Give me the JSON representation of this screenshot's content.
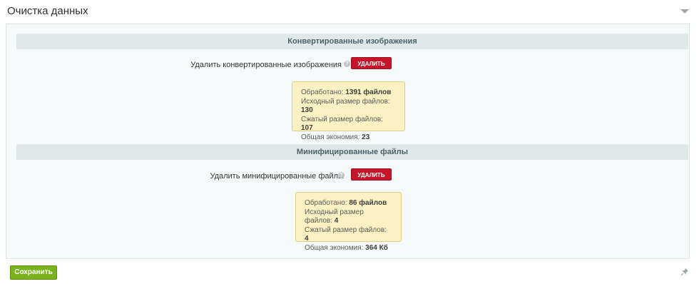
{
  "header": {
    "title": "Очистка данных",
    "toggle_icon": "chevron-down-icon"
  },
  "sections": [
    {
      "title": "Конвертированные изображения",
      "option_label": "Удалить конвертированные изображения",
      "button_label": "УДАЛИТЬ",
      "stats": {
        "processed_label": "Обработано:",
        "processed_value": "1391 файлов",
        "source_size_label": "Исходный размер файлов:",
        "source_size_value": "130",
        "compressed_size_label": "Сжатый размер файлов:",
        "compressed_size_value": "107",
        "savings_label": "Общая экономия:",
        "savings_value": "23"
      }
    },
    {
      "title": "Минифицированные файлы",
      "option_label": "Удалить минифицированные файлы",
      "button_label": "УДАЛИТЬ",
      "stats": {
        "processed_label": "Обработано:",
        "processed_value": "86 файлов",
        "source_size_label": "Исходный размер файлов:",
        "source_size_value": "4",
        "compressed_size_label": "Сжатый размер файлов:",
        "compressed_size_value": "4",
        "savings_label": "Общая экономия:",
        "savings_value": "364 Кб"
      }
    }
  ],
  "footer": {
    "save_label": "Сохранить"
  },
  "colors": {
    "delete_button": "#c4152b",
    "save_button": "#7ab21e",
    "stats_background": "#fbf1c3",
    "section_header": "#e0e8ea"
  }
}
